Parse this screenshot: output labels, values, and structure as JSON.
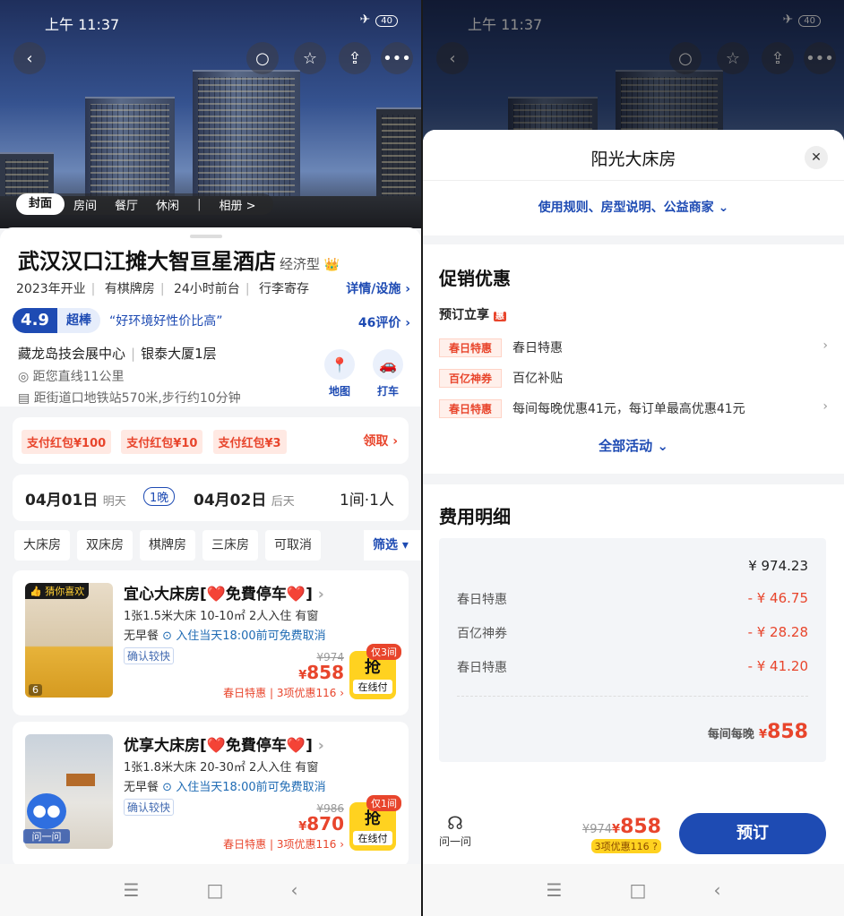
{
  "status": {
    "time": "上午 11:37",
    "battery": "40"
  },
  "hotel": {
    "name": "武汉汉口江摊大智亘星酒店",
    "type": "经济型",
    "tags": [
      "2023年开业",
      "有棋牌房",
      "24小时前台",
      "行李寄存"
    ],
    "detail_link": "详情/设施",
    "score": "4.9",
    "level": "超棒",
    "quote": "“好环境好性价比高”",
    "reviews": "46评价",
    "addr1": "藏龙岛技会展中心",
    "addr2": "银泰大厦1层",
    "distance": "距您直线11公里",
    "metro": "距街道口地铁站570米,步行约10分钟",
    "map_label": "地图",
    "taxi_label": "打车"
  },
  "gallery_tabs": [
    "封面",
    "房间",
    "餐厅",
    "休闲",
    "相册 >"
  ],
  "coupons": {
    "items": [
      "支付红包¥100",
      "支付红包¥10",
      "支付红包¥3"
    ],
    "claim": "领取"
  },
  "dates": {
    "checkin": "04月01日",
    "checkin_day": "明天",
    "nights": "1晚",
    "checkout": "04月02日",
    "checkout_day": "后天",
    "guests": "1间·1人"
  },
  "filters": [
    "大床房",
    "双床房",
    "棋牌房",
    "三床房",
    "可取消"
  ],
  "filter_btn": "筛选",
  "rooms": [
    {
      "badge": "猜你喜欢",
      "img_count": "6",
      "name": "宜心大床房[❤️免費停车❤️]",
      "spec": "1张1.5米大床  10-10㎡  2人入住  有窗",
      "meal": "无早餐",
      "cancel": "入住当天18:00前可免费取消",
      "confirm": "确认较快",
      "old": "¥974",
      "price": "858",
      "promo_a": "春日特惠",
      "promo_b": "3项优惠116",
      "grab": "抢",
      "grab_sub": "在线付",
      "only": "仅3间"
    },
    {
      "badge": "问一问",
      "img_count": "",
      "name": "优享大床房[❤️免費停车❤️]",
      "spec": "1张1.8米大床  20-30㎡  2人入住  有窗",
      "meal": "无早餐",
      "cancel": "入住当天18:00前可免费取消",
      "confirm": "确认较快",
      "old": "¥986",
      "price": "870",
      "promo_a": "春日特惠",
      "promo_b": "3项优惠116",
      "grab": "抢",
      "grab_sub": "在线付",
      "only": "仅1间"
    }
  ],
  "modal": {
    "title": "阳光大床房",
    "rules": "使用规则、房型说明、公益商家",
    "promo_title": "促销优惠",
    "book_share": "预订立享",
    "hui": "惠",
    "promos": [
      {
        "tag": "春日特惠",
        "text": "春日特惠"
      },
      {
        "tag": "百亿神券",
        "text": "百亿补贴"
      },
      {
        "tag": "春日特惠",
        "text": "每间每晚优惠41元，每订单最高优惠41元"
      }
    ],
    "all_activities": "全部活动",
    "fee_title": "费用明细",
    "fee_total": "¥ 974.23",
    "fees": [
      {
        "label": "春日特惠",
        "value": "- ¥ 46.75"
      },
      {
        "label": "百亿神券",
        "value": "- ¥ 28.28"
      },
      {
        "label": "春日特惠",
        "value": "- ¥ 41.20"
      }
    ],
    "per_night": "每间每晚",
    "final": "858",
    "ask": "问一问",
    "old_price": "¥974",
    "bar_price": "858",
    "bar_discount": "3项优惠116",
    "book": "预订"
  },
  "colors": {
    "brand": "#1e4bb3",
    "accent": "#e8452c",
    "yellow": "#ffd220"
  }
}
